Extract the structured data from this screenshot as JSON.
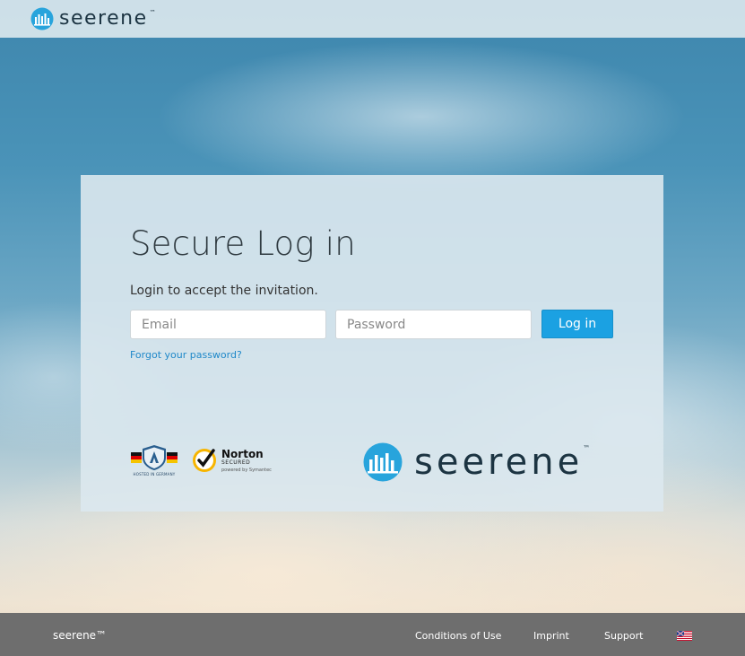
{
  "header": {
    "brand_name": "seerene",
    "brand_tm": "™"
  },
  "login": {
    "title": "Secure Log in",
    "subtitle": "Login to accept the invitation.",
    "email_placeholder": "Email",
    "email_value": "",
    "password_placeholder": "Password",
    "password_value": "",
    "login_button": "Log in",
    "forgot_link": "Forgot your password?"
  },
  "badges": {
    "hosted_caption": "HOSTED IN GERMANY",
    "norton_name": "Norton",
    "norton_secured": "SECURED",
    "norton_powered": "powered by Symantec"
  },
  "card_brand": {
    "name": "seerene",
    "tm": "™"
  },
  "footer": {
    "brand": "seerene™",
    "links": {
      "conditions": "Conditions of Use",
      "imprint": "Imprint",
      "support": "Support"
    },
    "language_flag": "us-flag-icon"
  },
  "colors": {
    "accent": "#1ba1e2",
    "brand_dark": "#1c3442",
    "footer_bg": "#6e6e6e",
    "link": "#1f88c9"
  }
}
